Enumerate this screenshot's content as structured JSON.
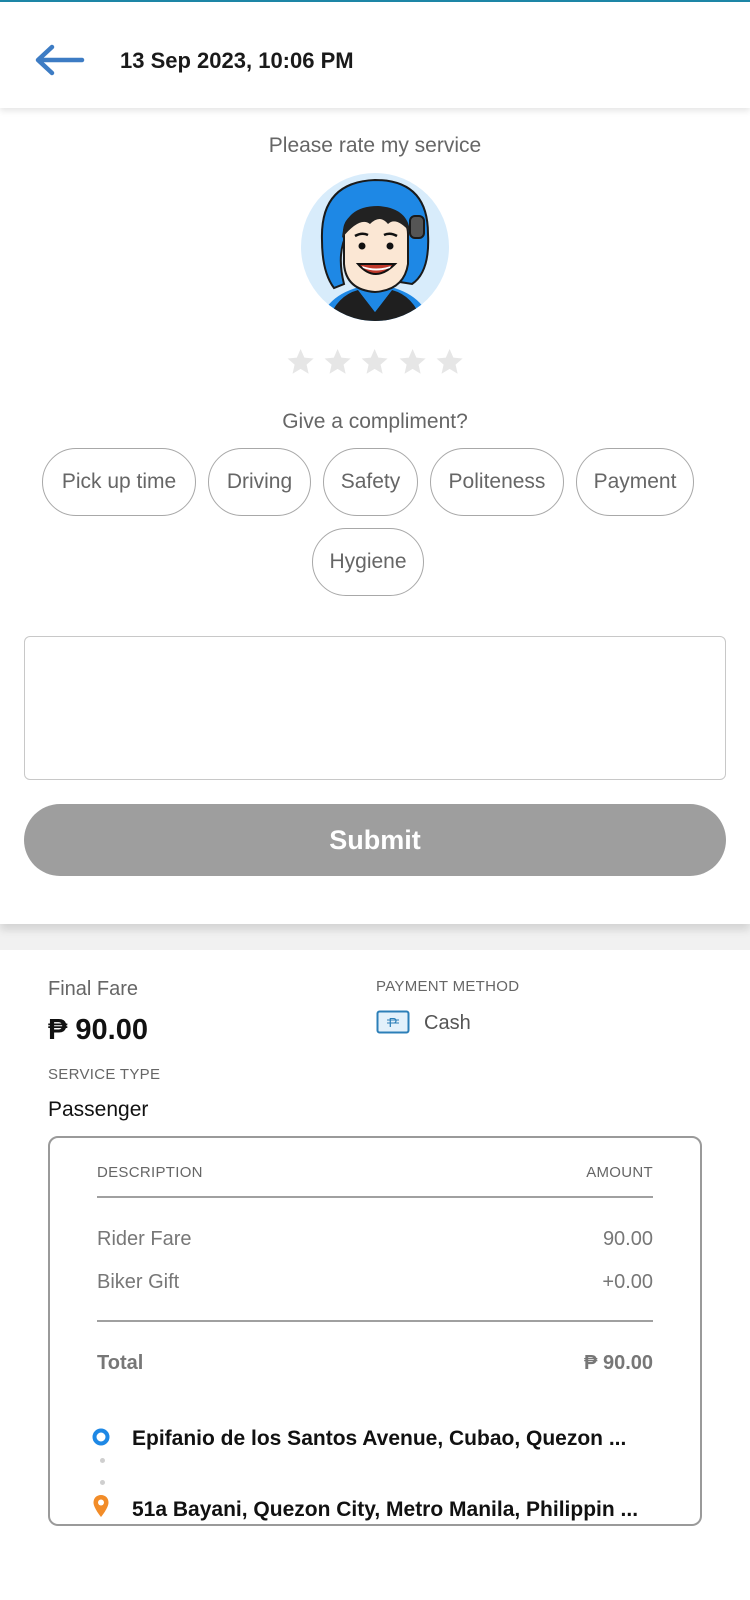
{
  "header": {
    "back_icon": "arrow-left-icon",
    "title": "13 Sep 2023, 10:06 PM"
  },
  "rating": {
    "prompt": "Please rate my service",
    "avatar_icon": "rider-avatar",
    "stars": 5,
    "compliment_prompt": "Give a compliment?",
    "chips": [
      "Pick up time",
      "Driving",
      "Safety",
      "Politeness",
      "Payment",
      "Hygiene"
    ],
    "comment": {
      "value": "",
      "placeholder": ""
    },
    "submit_label": "Submit"
  },
  "summary": {
    "final_fare_label": "Final Fare",
    "final_fare_value": "₱ 90.00",
    "payment_method_label": "PAYMENT METHOD",
    "payment_icon": "cash-icon",
    "payment_method_value": "Cash",
    "service_type_label": "SERVICE TYPE",
    "service_type_value": "Passenger"
  },
  "receipt": {
    "col_description": "DESCRIPTION",
    "col_amount": "AMOUNT",
    "rows": [
      {
        "label": "Rider Fare",
        "amount": "90.00"
      },
      {
        "label": "Biker Gift",
        "amount": "+0.00"
      }
    ],
    "total_label": "Total",
    "total_value": "₱ 90.00",
    "pickup": "Epifanio de los Santos Avenue, Cubao, Quezon ...",
    "dropoff": "51a Bayani, Quezon City, Metro Manila, Philippin ..."
  },
  "colors": {
    "accent_blue": "#1e88e5",
    "pin_orange": "#f28c28",
    "button_disabled": "#9e9e9e"
  }
}
